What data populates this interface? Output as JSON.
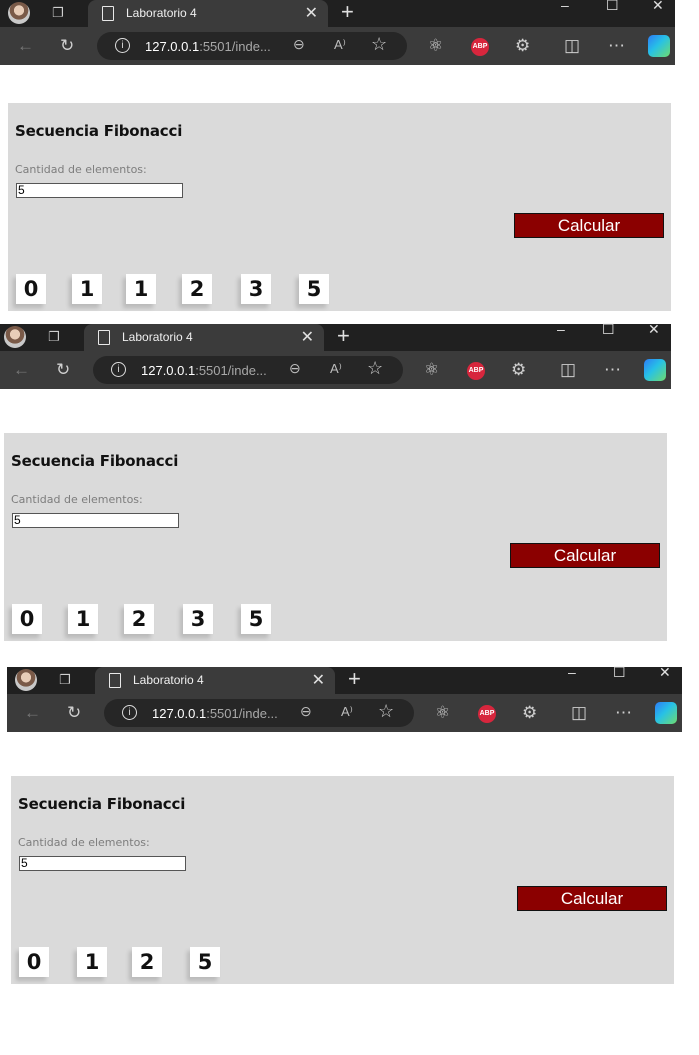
{
  "browser": {
    "tab_title": "Laboratorio 4",
    "tab_close": "✕",
    "new_tab": "+",
    "url_host": "127.0.0.1",
    "url_rest": ":5501/inde...",
    "window_controls": [
      "–",
      "☐",
      "✕"
    ]
  },
  "app": {
    "title": "Secuencia Fibonacci",
    "input_label": "Cantidad de elementos:",
    "input_value": "5",
    "button_label": "Calcular",
    "button_color": "#8b0000"
  },
  "screenshots": [
    {
      "sequence": [
        "0",
        "1",
        "1",
        "2",
        "3",
        "5"
      ]
    },
    {
      "sequence": [
        "0",
        "1",
        "2",
        "3",
        "5"
      ]
    },
    {
      "sequence": [
        "0",
        "1",
        "2",
        "5"
      ]
    }
  ]
}
